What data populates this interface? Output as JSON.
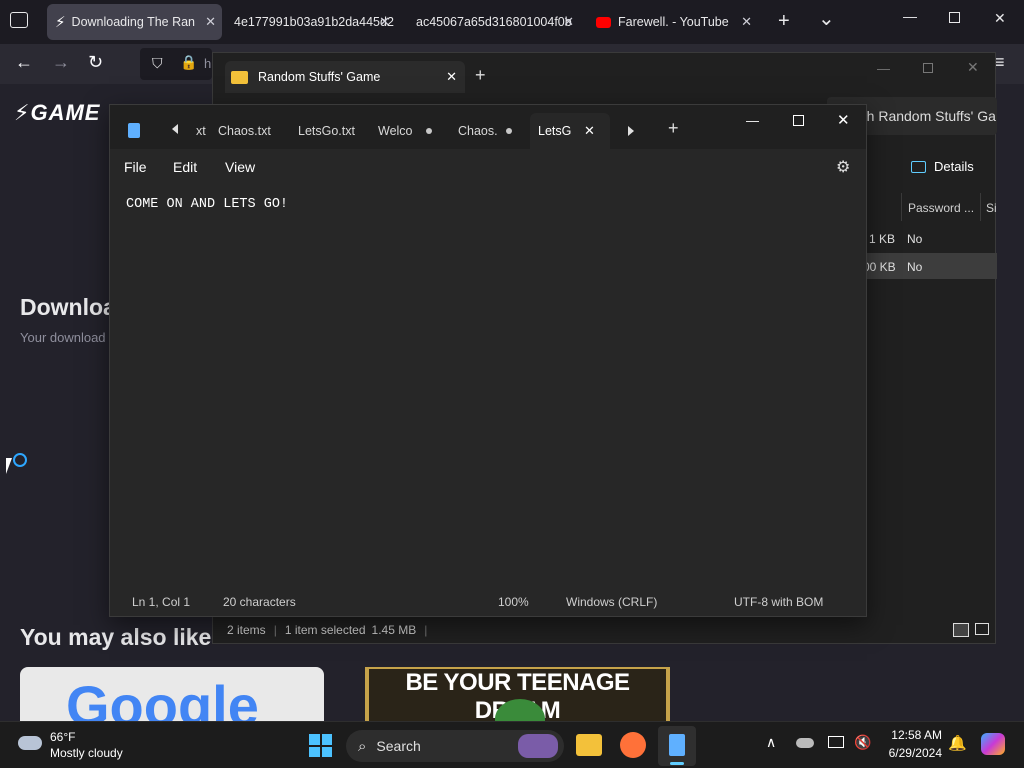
{
  "browser": {
    "tabs": [
      {
        "title": "Downloading The Ran",
        "active": true
      },
      {
        "title": "4e177991b03a91b2da445d2",
        "active": false
      },
      {
        "title": "ac45067a65d316801004f0b",
        "active": false
      },
      {
        "title": "Farewell. - YouTube",
        "active": false
      }
    ],
    "new_tab": "+",
    "tab_list": "⌄",
    "close_glyph": "✕",
    "address_prefix": "h"
  },
  "webpage": {
    "logo": "GAME",
    "download_heading": "Downloa",
    "download_sub": "Your download",
    "also_like": "You may also like",
    "thumb1_text": "Google",
    "thumb2_text": "BE YOUR TEENAGE DREAM",
    "search_partial": "rch Random Stuffs' Ga"
  },
  "explorer": {
    "tab_title": "Random Stuffs' Game",
    "details_label": "Details",
    "col_password": "Password ...",
    "col_size": "Si",
    "rows": [
      {
        "size": "1 KB",
        "password": "No"
      },
      {
        "size": "00 KB",
        "password": "No"
      }
    ],
    "status_items": "2 items",
    "status_selected": "1 item selected",
    "status_size": "1.45 MB"
  },
  "notepad": {
    "tabs": [
      {
        "label": "xt",
        "modified": false
      },
      {
        "label": "Chaos.txt",
        "modified": false
      },
      {
        "label": "LetsGo.txt",
        "modified": false
      },
      {
        "label": "Welco",
        "modified": true
      },
      {
        "label": "Chaos.",
        "modified": true
      },
      {
        "label": "LetsG",
        "modified": false,
        "active": true
      }
    ],
    "menu": {
      "file": "File",
      "edit": "Edit",
      "view": "View"
    },
    "content": "COME ON AND LETS GO!",
    "status": {
      "position": "Ln 1, Col 1",
      "chars": "20 characters",
      "zoom": "100%",
      "line_ending": "Windows (CRLF)",
      "encoding": "UTF-8 with BOM"
    }
  },
  "taskbar": {
    "weather_temp": "66°F",
    "weather_desc": "Mostly cloudy",
    "search_label": "Search",
    "time": "12:58 AM",
    "date": "6/29/2024"
  },
  "colors": {
    "accent": "#0078d4",
    "notepad_bg": "#272727",
    "browser_bg": "#1c1b22"
  }
}
